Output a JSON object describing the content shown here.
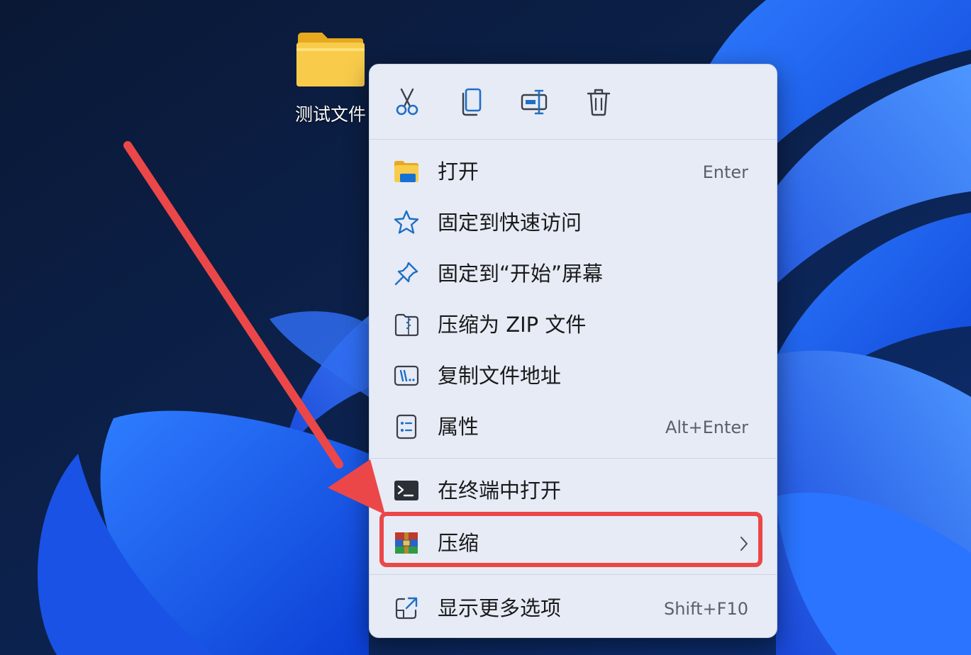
{
  "desktop": {
    "icon_label": "测试文件"
  },
  "context_menu": {
    "toolbar": [
      {
        "name": "cut-icon",
        "label": ""
      },
      {
        "name": "copy-icon",
        "label": ""
      },
      {
        "name": "rename-icon",
        "label": ""
      },
      {
        "name": "delete-icon",
        "label": ""
      }
    ],
    "items": [
      {
        "icon": "folder-open-icon",
        "label": "打开",
        "shortcut": "Enter"
      },
      {
        "icon": "star-icon",
        "label": "固定到快速访问",
        "shortcut": ""
      },
      {
        "icon": "pin-icon",
        "label": "固定到“开始”屏幕",
        "shortcut": ""
      },
      {
        "icon": "zip-folder-icon",
        "label": "压缩为 ZIP 文件",
        "shortcut": ""
      },
      {
        "icon": "copy-path-icon",
        "label": "复制文件地址",
        "shortcut": ""
      },
      {
        "icon": "properties-icon",
        "label": "属性",
        "shortcut": "Alt+Enter"
      },
      {
        "icon": "terminal-icon",
        "label": "在终端中打开",
        "shortcut": ""
      },
      {
        "icon": "winrar-icon",
        "label": "压缩",
        "shortcut": "",
        "submenu": true
      },
      {
        "icon": "show-more-icon",
        "label": "显示更多选项",
        "shortcut": "Shift+F10"
      }
    ]
  },
  "colors": {
    "accent": "#1e6fc4",
    "menu_background": "#e6ebf6",
    "annotation_red": "#ec4748"
  }
}
